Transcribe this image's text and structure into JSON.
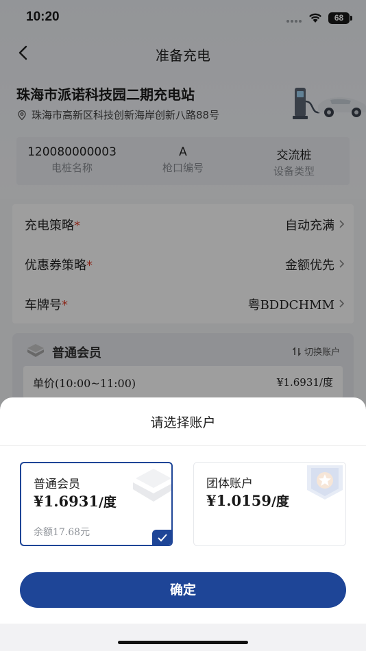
{
  "status_bar": {
    "time": "10:20",
    "battery": "68"
  },
  "nav": {
    "title": "准备充电",
    "back_icon": "chevron-left-icon"
  },
  "station": {
    "name": "珠海市派诺科技园二期充电站",
    "address": "珠海市高新区科技创新海岸创新八路88号"
  },
  "info": [
    {
      "value": "120080000003",
      "label": "电桩名称"
    },
    {
      "value": "A",
      "label": "枪口编号"
    },
    {
      "value": "交流桩",
      "label": "设备类型"
    }
  ],
  "settings": [
    {
      "label": "充电策略",
      "required": "*",
      "value": "自动充满"
    },
    {
      "label": "优惠券策略",
      "required": "*",
      "value": "金额优先"
    },
    {
      "label": "车牌号",
      "required": "*",
      "value": "粤BDDCHMM"
    }
  ],
  "member": {
    "title": "普通会员",
    "switch_label": "切换账户",
    "price_label": "单价(10:00~11:00)",
    "price_value": "¥1.6931/度"
  },
  "sheet": {
    "title": "请选择账户",
    "accounts": [
      {
        "name": "普通会员",
        "price": "¥1.6931",
        "unit": "/度",
        "balance": "余额17.68元",
        "selected": true
      },
      {
        "name": "团体账户",
        "price": "¥1.0159",
        "unit": "/度",
        "selected": false
      }
    ],
    "confirm_label": "确定"
  },
  "colors": {
    "primary": "#1e4597",
    "required": "#e0402a"
  }
}
